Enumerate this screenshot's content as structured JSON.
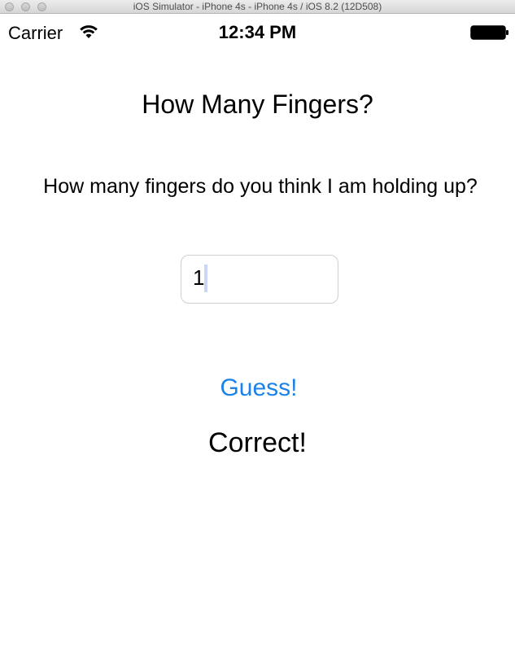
{
  "window": {
    "title": "iOS Simulator - iPhone 4s - iPhone 4s / iOS 8.2 (12D508)"
  },
  "status_bar": {
    "carrier": "Carrier",
    "time": "12:34 PM",
    "wifi_icon": "wifi-icon",
    "battery_icon": "battery-icon"
  },
  "app": {
    "title": "How Many Fingers?",
    "question": "How many fingers do you think I am holding up?",
    "answer_input_value": "1",
    "guess_button_label": "Guess!",
    "result_text": "Correct!"
  },
  "colors": {
    "accent": "#1a82e8",
    "text": "#000000",
    "background": "#ffffff"
  }
}
